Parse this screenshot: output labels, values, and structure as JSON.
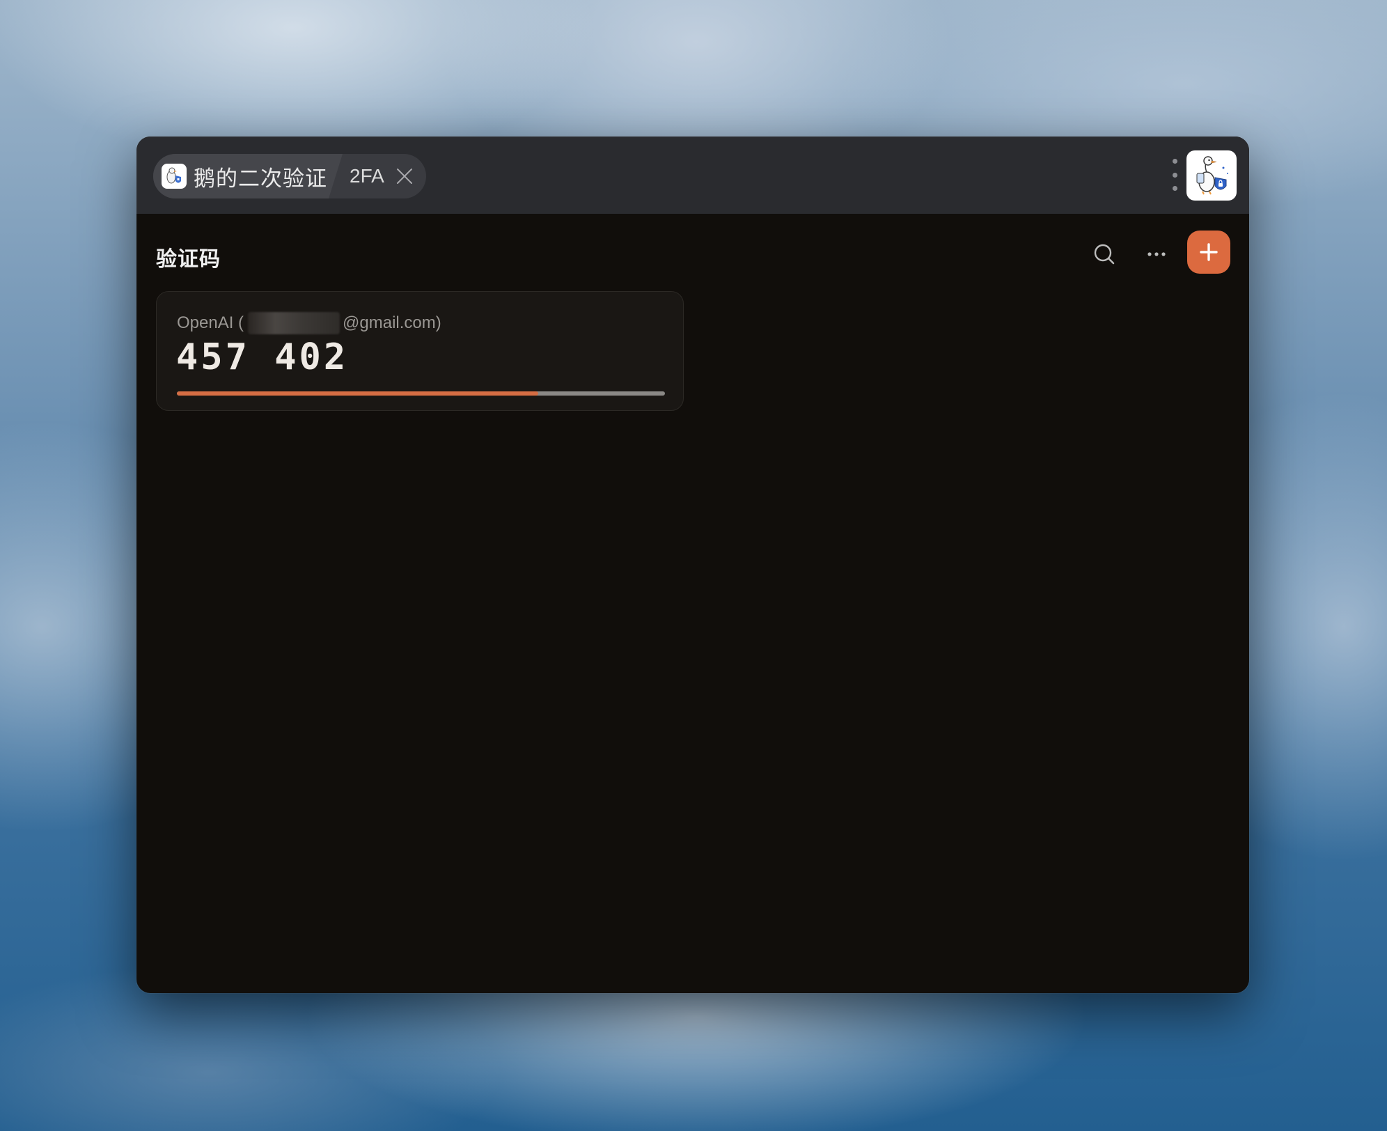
{
  "window": {
    "tab_app_label": "鹅的二次验证",
    "tab_sub_label": "2FA"
  },
  "main": {
    "section_title": "验证码"
  },
  "accounts": [
    {
      "issuer_prefix": "OpenAI (",
      "email_suffix": "@gmail.com)",
      "code": "457 402",
      "time_remaining_fraction": 0.74
    }
  ],
  "colors": {
    "accent": "#dc6a3f",
    "progress_fill": "#d66e44",
    "progress_track": "#8b8986",
    "background": "#110e0b",
    "titlebar": "#2a2b2f"
  },
  "icons": {
    "tab_close": "close-icon",
    "menu": "kebab-menu-icon",
    "avatar": "goose-shield-avatar",
    "search": "search-icon",
    "more": "more-horizontal-icon",
    "add": "plus-icon"
  }
}
